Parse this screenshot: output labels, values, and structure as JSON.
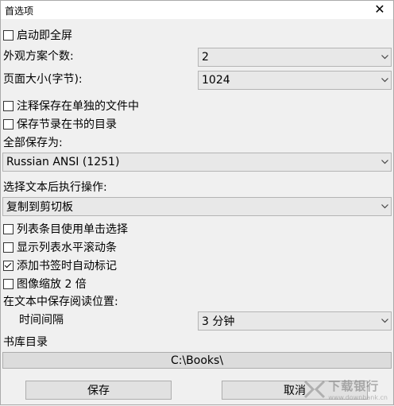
{
  "window": {
    "title": "首选项",
    "close_glyph": "✕"
  },
  "options": {
    "fullscreen": {
      "label": "启动即全屏",
      "checked": false
    },
    "schemes_label": "外观方案个数:",
    "schemes_value": "2",
    "page_size_label": "页面大小(字节):",
    "page_size_value": "1024",
    "notes_separate": {
      "label": "注释保存在单独的文件中",
      "checked": false
    },
    "save_in_book_dir": {
      "label": "保存节录在书的目录",
      "checked": false
    },
    "save_all_label": "全部保存为:",
    "encoding_value": "Russian ANSI (1251)",
    "after_select_label": "选择文本后执行操作:",
    "after_select_value": "复制到剪切板",
    "single_click": {
      "label": "列表条目使用单击选择",
      "checked": false
    },
    "hscroll": {
      "label": "显示列表水平滚动条",
      "checked": false
    },
    "auto_mark": {
      "label": "添加书签时自动标记",
      "checked": true
    },
    "image_zoom": {
      "label": "图像缩放 2 倍",
      "checked": false
    },
    "save_position_label": "在文本中保存阅读位置:",
    "interval_label": "时间间隔",
    "interval_value": "3 分钟",
    "library_label": "书库目录",
    "library_path": "C:\\Books\\"
  },
  "buttons": {
    "save": "保存",
    "cancel": "取消"
  },
  "watermark": {
    "text": "下载银行",
    "sub": "www.downbank.cn"
  }
}
